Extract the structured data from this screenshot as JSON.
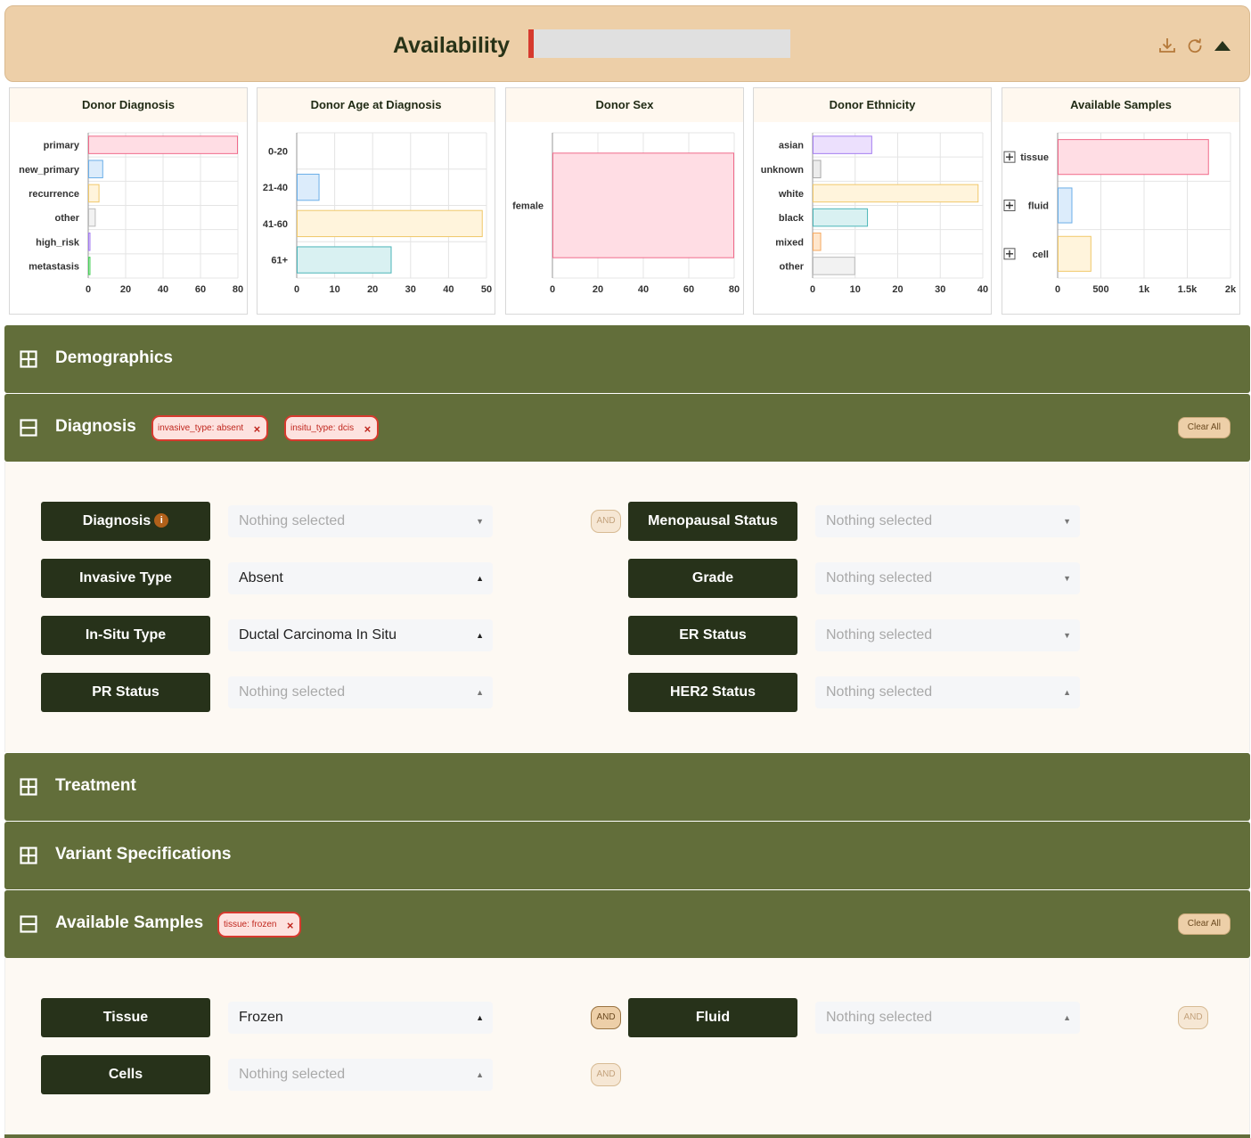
{
  "header": {
    "title": "Availability"
  },
  "charts": [
    {
      "title": "Donor Diagnosis",
      "type": "bar",
      "orientation": "horizontal",
      "categories": [
        "primary",
        "new_primary",
        "recurrence",
        "other",
        "high_risk",
        "metastasis"
      ],
      "values": [
        80,
        8,
        6,
        4,
        1,
        1
      ],
      "xlim": [
        0,
        80
      ],
      "ticks": [
        "0",
        "20",
        "40",
        "60",
        "80"
      ],
      "colors": [
        "#ffdde4",
        "#dcecfb",
        "#fff4dc",
        "#f2f2f2",
        "#ece0fd",
        "#d6f5da"
      ],
      "strokes": [
        "#f06a8a",
        "#6aaee8",
        "#f0c86a",
        "#bbbbbb",
        "#a57ef0",
        "#4cd05c"
      ]
    },
    {
      "title": "Donor Age at Diagnosis",
      "type": "bar",
      "orientation": "horizontal",
      "categories": [
        "0-20",
        "21-40",
        "41-60",
        "61+"
      ],
      "values": [
        0,
        6,
        49,
        25
      ],
      "xlim": [
        0,
        50
      ],
      "ticks": [
        "0",
        "10",
        "20",
        "30",
        "40",
        "50"
      ],
      "colors": [
        "#ffdde4",
        "#dcecfb",
        "#fff4dc",
        "#d9f1f2"
      ],
      "strokes": [
        "#f06a8a",
        "#6aaee8",
        "#f0c86a",
        "#4bb5b8"
      ]
    },
    {
      "title": "Donor Sex",
      "type": "bar",
      "orientation": "horizontal",
      "categories": [
        "female"
      ],
      "values": [
        80
      ],
      "xlim": [
        0,
        80
      ],
      "ticks": [
        "0",
        "20",
        "40",
        "60",
        "80"
      ],
      "colors": [
        "#ffdde4"
      ],
      "strokes": [
        "#f06a8a"
      ]
    },
    {
      "title": "Donor Ethnicity",
      "type": "bar",
      "orientation": "horizontal",
      "categories": [
        "asian",
        "unknown",
        "white",
        "black",
        "mixed",
        "other"
      ],
      "values": [
        14,
        2,
        39,
        13,
        2,
        10
      ],
      "xlim": [
        0,
        40
      ],
      "ticks": [
        "0",
        "10",
        "20",
        "30",
        "40"
      ],
      "colors": [
        "#ece0fd",
        "#ececec",
        "#fff4dc",
        "#d9f1f2",
        "#ffe6cc",
        "#f2f2f2"
      ],
      "strokes": [
        "#a57ef0",
        "#aaaaaa",
        "#f0c86a",
        "#4bb5b8",
        "#f5a860",
        "#bbbbbb"
      ]
    },
    {
      "title": "Available Samples",
      "type": "bar",
      "orientation": "horizontal",
      "categories": [
        "tissue",
        "fluid",
        "cell"
      ],
      "values": [
        1750,
        170,
        390
      ],
      "xlim": [
        0,
        2000
      ],
      "ticks": [
        "0",
        "500",
        "1k",
        "1.5k",
        "2k"
      ],
      "expandable": true,
      "colors": [
        "#ffdde4",
        "#dcecfb",
        "#fff4dc"
      ],
      "strokes": [
        "#f06a8a",
        "#6aaee8",
        "#f0c86a"
      ]
    }
  ],
  "chart_data": [
    {
      "type": "bar",
      "title": "Donor Diagnosis",
      "categories": [
        "primary",
        "new_primary",
        "recurrence",
        "other",
        "high_risk",
        "metastasis"
      ],
      "values": [
        80,
        8,
        6,
        4,
        1,
        1
      ],
      "xlim": [
        0,
        80
      ]
    },
    {
      "type": "bar",
      "title": "Donor Age at Diagnosis",
      "categories": [
        "0-20",
        "21-40",
        "41-60",
        "61+"
      ],
      "values": [
        0,
        6,
        49,
        25
      ],
      "xlim": [
        0,
        50
      ]
    },
    {
      "type": "bar",
      "title": "Donor Sex",
      "categories": [
        "female"
      ],
      "values": [
        80
      ],
      "xlim": [
        0,
        80
      ]
    },
    {
      "type": "bar",
      "title": "Donor Ethnicity",
      "categories": [
        "asian",
        "unknown",
        "white",
        "black",
        "mixed",
        "other"
      ],
      "values": [
        14,
        2,
        39,
        13,
        2,
        10
      ],
      "xlim": [
        0,
        40
      ]
    },
    {
      "type": "bar",
      "title": "Available Samples",
      "categories": [
        "tissue",
        "fluid",
        "cell"
      ],
      "values": [
        1750,
        170,
        390
      ],
      "xlim": [
        0,
        2000
      ]
    }
  ],
  "sections": {
    "demographics": {
      "title": "Demographics",
      "icon": "expand-icon"
    },
    "diagnosis": {
      "title": "Diagnosis",
      "icon": "collapse-icon",
      "chips": [
        "invasive_type: absent",
        "insitu_type: dcis"
      ],
      "chip_x": "×",
      "clear_all": "Clear All"
    },
    "treatment": {
      "title": "Treatment",
      "icon": "expand-icon"
    },
    "variant": {
      "title": "Variant Specifications",
      "icon": "expand-icon"
    },
    "samples": {
      "title": "Available Samples",
      "icon": "collapse-icon",
      "chips": [
        "tissue: frozen"
      ],
      "chip_x": "×",
      "clear_all": "Clear All"
    }
  },
  "diagnosis_filters": [
    {
      "label": "Diagnosis",
      "value": "Nothing selected",
      "info": "i"
    },
    {
      "label": "Invasive Type",
      "value": "Absent"
    },
    {
      "label": "In-Situ Type",
      "value": "Ductal Carcinoma In Situ"
    },
    {
      "label": "PR Status",
      "value": "Nothing selected"
    },
    {
      "label": "Menopausal Status",
      "value": "Nothing selected"
    },
    {
      "label": "Grade",
      "value": "Nothing selected"
    },
    {
      "label": "ER Status",
      "value": "Nothing selected"
    },
    {
      "label": "HER2 Status",
      "value": "Nothing selected"
    }
  ],
  "sample_filters": [
    {
      "label": "Tissue",
      "value": "Frozen"
    },
    {
      "label": "Cells",
      "value": "Nothing selected"
    },
    {
      "label": "Fluid",
      "value": "Nothing selected"
    }
  ],
  "and_label": "AND"
}
